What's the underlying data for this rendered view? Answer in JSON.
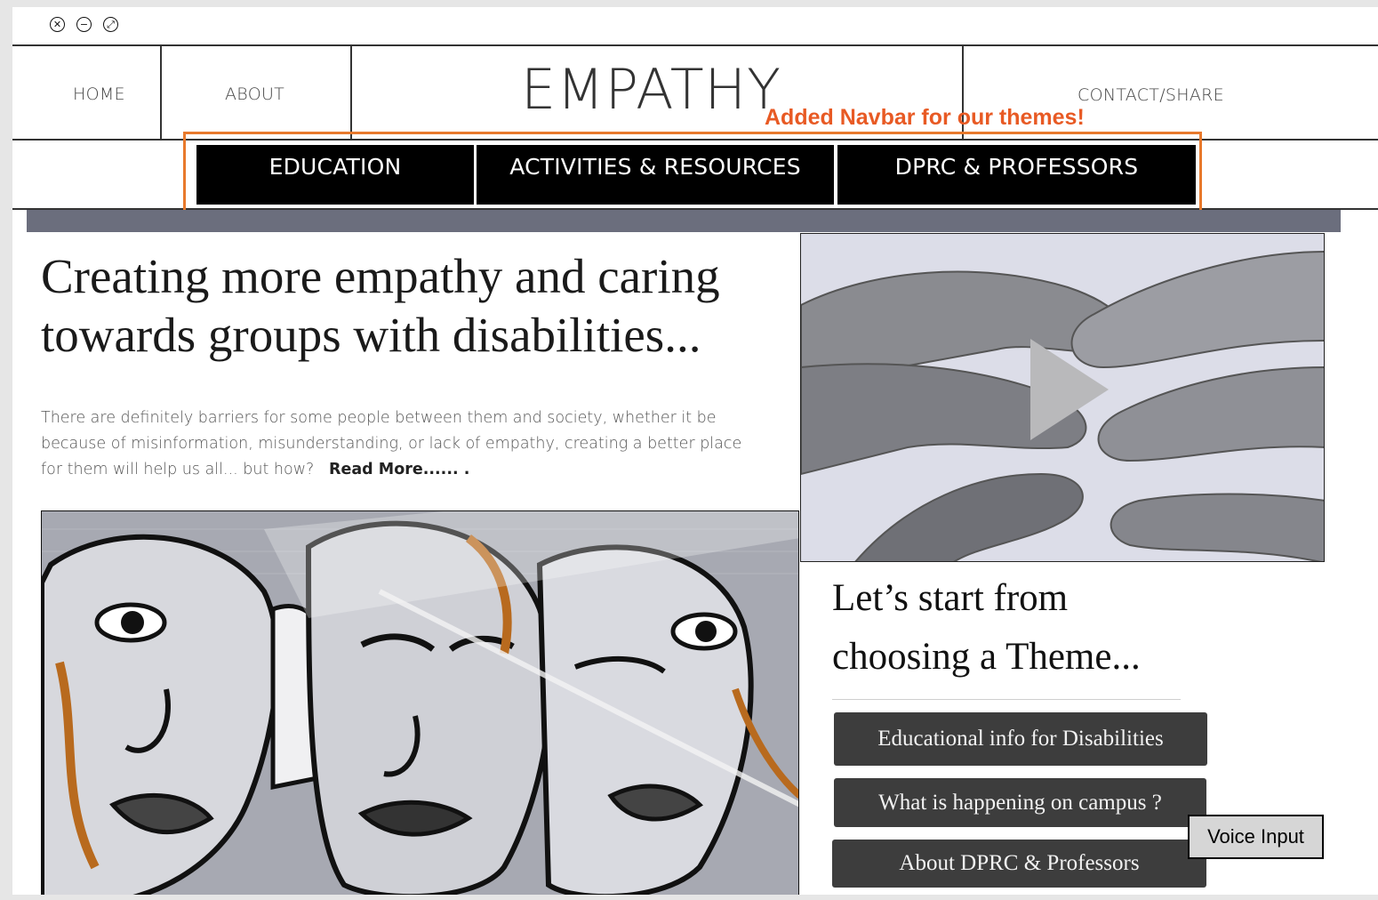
{
  "nav": {
    "home": "HOME",
    "about": "ABOUT",
    "brand": "EMPATHY",
    "contact": "CONTACT/SHARE"
  },
  "annotation": "Added Navbar for our themes!",
  "theme_nav": [
    "EDUCATION",
    "ACTIVITIES & RESOURCES",
    "DPRC & PROFESSORS"
  ],
  "hero": {
    "headline": "Creating more empathy and caring towards groups with disabilities...",
    "body": "There are definitely barriers for some people between them and society, whether it be because of misinformation, misunderstanding, or lack of empathy, creating a better place for them will help us all... but how?",
    "read_more": "Read More...... ."
  },
  "side": {
    "title_line1": "Let’s start from",
    "title_line2": "choosing a Theme...",
    "buttons": [
      "Educational info for Disabilities",
      "What is happening on campus ?",
      "About DPRC & Professors"
    ]
  },
  "voice_input": "Voice Input",
  "icons": {
    "close": "close-icon",
    "minimize": "minimize-icon",
    "fullscreen": "fullscreen-icon",
    "play": "play-icon"
  },
  "colors": {
    "annotation": "#e85a24",
    "annotation_box": "#e8792c",
    "band": "#6b6e7d",
    "theme_button": "#3d3d3d"
  }
}
